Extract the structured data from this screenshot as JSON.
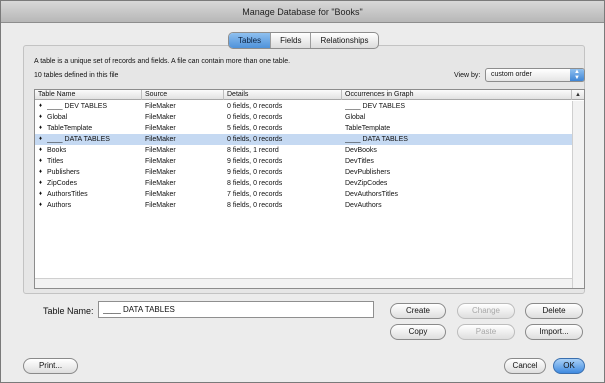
{
  "window": {
    "title": "Manage Database for \"Books\""
  },
  "tabs": [
    {
      "label": "Tables",
      "active": true
    },
    {
      "label": "Fields",
      "active": false
    },
    {
      "label": "Relationships",
      "active": false
    }
  ],
  "description": "A table is a unique set of records and fields. A file can contain more than one table.",
  "count_text": "10 tables defined in this file",
  "view_by": {
    "label": "View by:",
    "value": "custom order"
  },
  "table": {
    "columns": [
      "Table Name",
      "Source",
      "Details",
      "Occurrences in Graph"
    ],
    "rows": [
      {
        "name": "____ DEV TABLES",
        "source": "FileMaker",
        "details": "0 fields, 0 records",
        "occurrences": "____ DEV TABLES",
        "selected": false
      },
      {
        "name": "Global",
        "source": "FileMaker",
        "details": "0 fields, 0 records",
        "occurrences": "Global",
        "selected": false
      },
      {
        "name": "TableTemplate",
        "source": "FileMaker",
        "details": "5 fields, 0 records",
        "occurrences": "TableTemplate",
        "selected": false
      },
      {
        "name": "____ DATA TABLES",
        "source": "FileMaker",
        "details": "0 fields, 0 records",
        "occurrences": "____ DATA TABLES",
        "selected": true
      },
      {
        "name": "Books",
        "source": "FileMaker",
        "details": "8 fields, 1 record",
        "occurrences": "DevBooks",
        "selected": false
      },
      {
        "name": "Titles",
        "source": "FileMaker",
        "details": "9 fields, 0 records",
        "occurrences": "DevTitles",
        "selected": false
      },
      {
        "name": "Publishers",
        "source": "FileMaker",
        "details": "9 fields, 0 records",
        "occurrences": "DevPublishers",
        "selected": false
      },
      {
        "name": "ZipCodes",
        "source": "FileMaker",
        "details": "8 fields, 0 records",
        "occurrences": "DevZipCodes",
        "selected": false
      },
      {
        "name": "AuthorsTitles",
        "source": "FileMaker",
        "details": "7 fields, 0 records",
        "occurrences": "DevAuthorsTitles",
        "selected": false
      },
      {
        "name": "Authors",
        "source": "FileMaker",
        "details": "8 fields, 0 records",
        "occurrences": "DevAuthors",
        "selected": false
      }
    ]
  },
  "table_name": {
    "label": "Table Name:",
    "value": "____ DATA TABLES"
  },
  "buttons": {
    "create": "Create",
    "change": "Change",
    "delete": "Delete",
    "copy": "Copy",
    "paste": "Paste",
    "import": "Import...",
    "print": "Print...",
    "cancel": "Cancel",
    "ok": "OK"
  },
  "colors": {
    "selected_row": "#c5d9f2",
    "accent": "#3f8ae0"
  }
}
